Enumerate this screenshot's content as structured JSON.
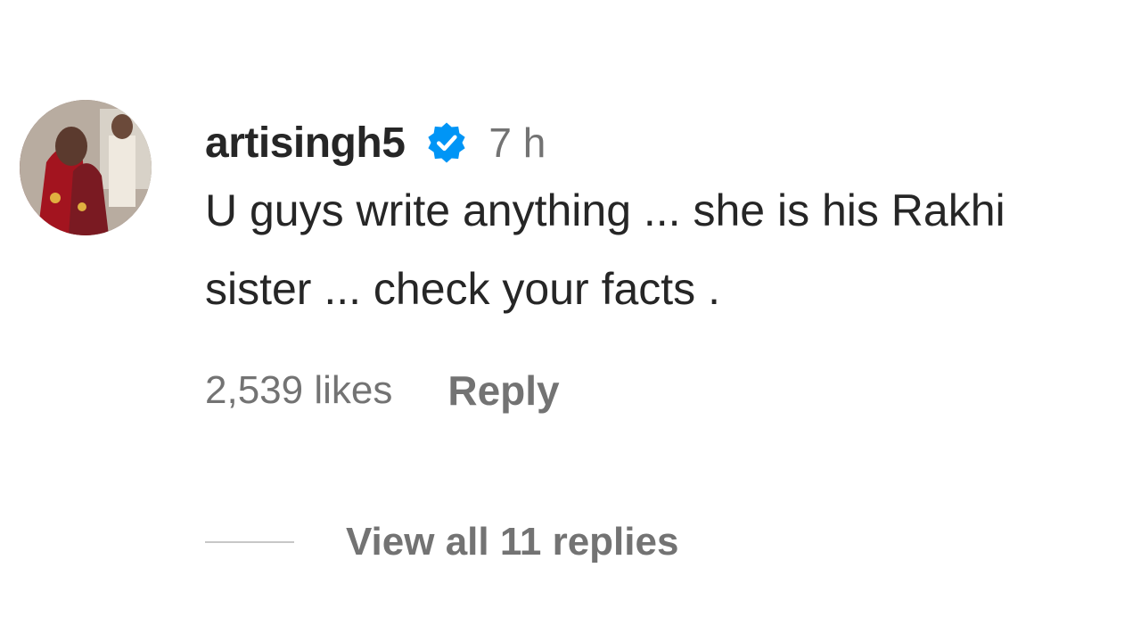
{
  "comment": {
    "username": "artisingh5",
    "verified_icon": "verified-badge-icon",
    "time": "7 h",
    "text": "U guys write anything ... she is his Rakhi sister ... check your facts .",
    "likes": "2,539 likes",
    "reply_label": "Reply",
    "view_replies_label": "View all 11 replies"
  },
  "colors": {
    "primary_text": "#262626",
    "secondary_text": "#737373",
    "verified_blue": "#0095f6",
    "divider": "#c7c7c7"
  }
}
